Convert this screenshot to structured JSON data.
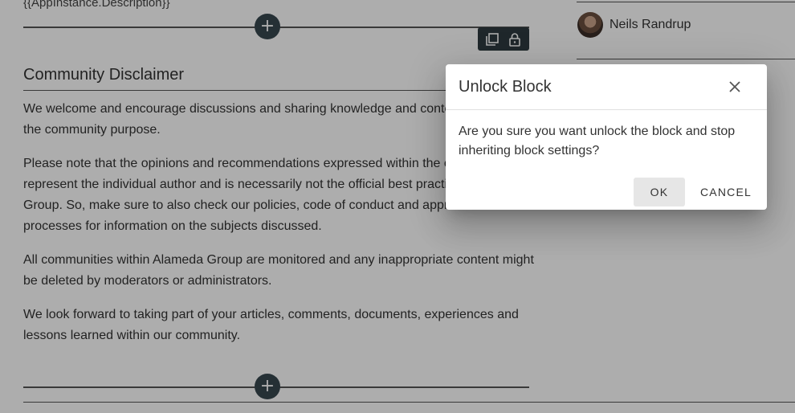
{
  "app_description": "{{AppInstance.Description}}",
  "add_symbol": "+",
  "toolbar": {
    "copy_icon": "copy-icon",
    "lock_icon": "lock-icon"
  },
  "section": {
    "title": "Community Disclaimer",
    "paragraphs": [
      "We welcome and encourage discussions and sharing knowledge and content related to the community purpose.",
      "Please note that the opinions and recommendations expressed within the community represent the individual author and is necessarily not the official best practice of Alameda Group. So, make sure to also check our policies, code of conduct and approved business processes for information on the subjects discussed.",
      "All communities within Alameda Group are monitored and any inappropriate content might be deleted by moderators or administrators.",
      "We look forward to taking part of your articles, comments, documents, experiences and lessons learned within our community."
    ]
  },
  "sidebar": {
    "user_name": "Neils Randrup"
  },
  "dialog": {
    "title": "Unlock Block",
    "message": "Are you sure you want unlock the block and stop inheriting block settings?",
    "ok_label": "OK",
    "cancel_label": "CANCEL",
    "close_icon": "close-icon"
  },
  "colors": {
    "add_button": "#37474f",
    "toolbar": "#2e3a40",
    "overlay": "rgba(0,0,0,0.32)"
  }
}
